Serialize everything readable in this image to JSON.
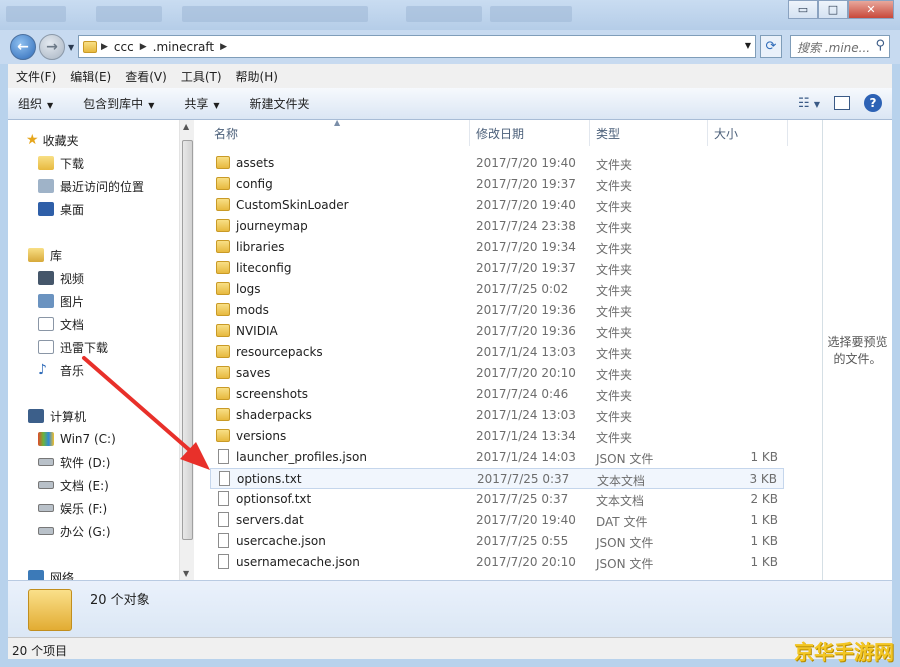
{
  "window": {
    "controls": [
      "▭",
      "□",
      "✕"
    ]
  },
  "address": {
    "segments": [
      "ccc",
      ".minecraft"
    ],
    "search_placeholder": "搜索 .mine..."
  },
  "menu": [
    "文件(F)",
    "编辑(E)",
    "查看(V)",
    "工具(T)",
    "帮助(H)"
  ],
  "toolbar": {
    "organize": "组织",
    "include": "包含到库中",
    "share": "共享",
    "new_folder": "新建文件夹"
  },
  "nav": {
    "favorites": "收藏夹",
    "fav_items": [
      "下载",
      "最近访问的位置",
      "桌面"
    ],
    "libraries": "库",
    "lib_items": [
      "视频",
      "图片",
      "文档",
      "迅雷下载",
      "音乐"
    ],
    "computer": "计算机",
    "drives": [
      "Win7 (C:)",
      "软件 (D:)",
      "文档 (E:)",
      "娱乐 (F:)",
      "办公 (G:)"
    ],
    "network": "网络"
  },
  "columns": {
    "name": "名称",
    "date": "修改日期",
    "type": "类型",
    "size": "大小"
  },
  "files": [
    {
      "name": "assets",
      "date": "2017/7/20 19:40",
      "type": "文件夹",
      "size": "",
      "kind": "folder"
    },
    {
      "name": "config",
      "date": "2017/7/20 19:37",
      "type": "文件夹",
      "size": "",
      "kind": "folder"
    },
    {
      "name": "CustomSkinLoader",
      "date": "2017/7/20 19:40",
      "type": "文件夹",
      "size": "",
      "kind": "folder"
    },
    {
      "name": "journeymap",
      "date": "2017/7/24 23:38",
      "type": "文件夹",
      "size": "",
      "kind": "folder"
    },
    {
      "name": "libraries",
      "date": "2017/7/20 19:34",
      "type": "文件夹",
      "size": "",
      "kind": "folder"
    },
    {
      "name": "liteconfig",
      "date": "2017/7/20 19:37",
      "type": "文件夹",
      "size": "",
      "kind": "folder"
    },
    {
      "name": "logs",
      "date": "2017/7/25 0:02",
      "type": "文件夹",
      "size": "",
      "kind": "folder"
    },
    {
      "name": "mods",
      "date": "2017/7/20 19:36",
      "type": "文件夹",
      "size": "",
      "kind": "folder"
    },
    {
      "name": "NVIDIA",
      "date": "2017/7/20 19:36",
      "type": "文件夹",
      "size": "",
      "kind": "folder"
    },
    {
      "name": "resourcepacks",
      "date": "2017/1/24 13:03",
      "type": "文件夹",
      "size": "",
      "kind": "folder"
    },
    {
      "name": "saves",
      "date": "2017/7/20 20:10",
      "type": "文件夹",
      "size": "",
      "kind": "folder"
    },
    {
      "name": "screenshots",
      "date": "2017/7/24 0:46",
      "type": "文件夹",
      "size": "",
      "kind": "folder"
    },
    {
      "name": "shaderpacks",
      "date": "2017/1/24 13:03",
      "type": "文件夹",
      "size": "",
      "kind": "folder"
    },
    {
      "name": "versions",
      "date": "2017/1/24 13:34",
      "type": "文件夹",
      "size": "",
      "kind": "folder"
    },
    {
      "name": "launcher_profiles.json",
      "date": "2017/1/24 14:03",
      "type": "JSON 文件",
      "size": "1 KB",
      "kind": "file"
    },
    {
      "name": "options.txt",
      "date": "2017/7/25 0:37",
      "type": "文本文档",
      "size": "3 KB",
      "kind": "file",
      "selected": true
    },
    {
      "name": "optionsof.txt",
      "date": "2017/7/25 0:37",
      "type": "文本文档",
      "size": "2 KB",
      "kind": "file"
    },
    {
      "name": "servers.dat",
      "date": "2017/7/20 19:40",
      "type": "DAT 文件",
      "size": "1 KB",
      "kind": "file"
    },
    {
      "name": "usercache.json",
      "date": "2017/7/25 0:55",
      "type": "JSON 文件",
      "size": "1 KB",
      "kind": "file"
    },
    {
      "name": "usernamecache.json",
      "date": "2017/7/20 20:10",
      "type": "JSON 文件",
      "size": "1 KB",
      "kind": "file"
    }
  ],
  "preview_text": "选择要预览的文件。",
  "details": {
    "count": "20 个对象"
  },
  "status": {
    "text": "20 个项目"
  },
  "watermark": "京华手游网",
  "colors": {
    "accent": "#2f6bb8",
    "arrow": "#e8302a",
    "folder": "#e7b93f"
  }
}
